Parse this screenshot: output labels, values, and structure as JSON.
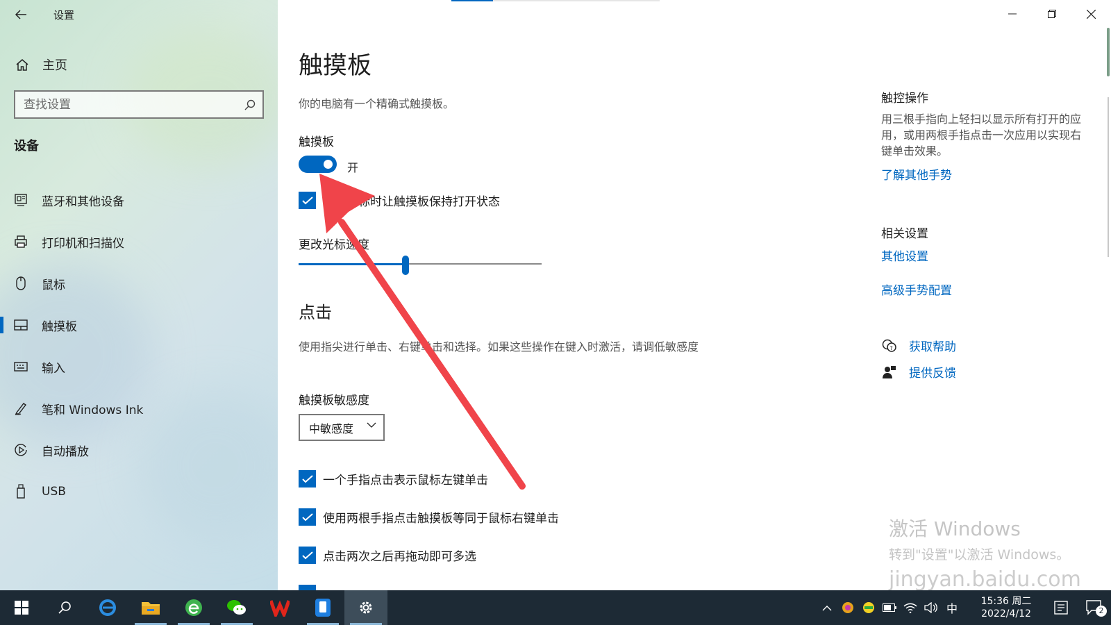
{
  "window": {
    "title": "设置"
  },
  "sidebar": {
    "home_label": "主页",
    "search_placeholder": "查找设置",
    "section_title": "设备",
    "items": [
      {
        "label": "蓝牙和其他设备",
        "icon": "bluetooth-devices-icon"
      },
      {
        "label": "打印机和扫描仪",
        "icon": "printer-icon"
      },
      {
        "label": "鼠标",
        "icon": "mouse-icon"
      },
      {
        "label": "触摸板",
        "icon": "touchpad-icon",
        "active": true
      },
      {
        "label": "输入",
        "icon": "keyboard-icon"
      },
      {
        "label": "笔和 Windows Ink",
        "icon": "pen-icon"
      },
      {
        "label": "自动播放",
        "icon": "autoplay-icon"
      },
      {
        "label": "USB",
        "icon": "usb-icon"
      }
    ]
  },
  "main": {
    "title": "触摸板",
    "description": "你的电脑有一个精确式触摸板。",
    "touchpad_label": "触摸板",
    "toggle_state": "开",
    "keep_on_label": "连接鼠标时让触摸板保持打开状态",
    "cursor_speed_label": "更改光标速度",
    "cursor_speed_fraction": 0.44,
    "taps_heading": "点击",
    "taps_description": "使用指尖进行单击、右键单击和选择。如果这些操作在键入时激活，请调低敏感度",
    "sensitivity_label": "触摸板敏感度",
    "sensitivity_value": "中敏感度",
    "checkboxes": [
      "一个手指点击表示鼠标左键单击",
      "使用两根手指点击触摸板等同于鼠标右键单击",
      "点击两次之后再拖动即可多选"
    ]
  },
  "right_panel": {
    "touch_heading": "触控操作",
    "touch_text": "用三根手指向上轻扫以显示所有打开的应用，或用两根手指点击一次应用以实现右键单击效果。",
    "learn_link": "了解其他手势",
    "related_heading": "相关设置",
    "other_settings_link": "其他设置",
    "advanced_link": "高级手势配置",
    "help_link": "获取帮助",
    "feedback_link": "提供反馈"
  },
  "watermark": {
    "line1": "激活 Windows",
    "line2": "转到\"设置\"以激活 Windows。",
    "brand": "jingyan.baidu.com"
  },
  "taskbar": {
    "ime": "中",
    "time": "15:36 周二",
    "date": "2022/4/12",
    "notification_count": "2"
  },
  "colors": {
    "accent": "#0067c0",
    "taskbar": "#1d2a35",
    "arrow": "#f0444a"
  }
}
